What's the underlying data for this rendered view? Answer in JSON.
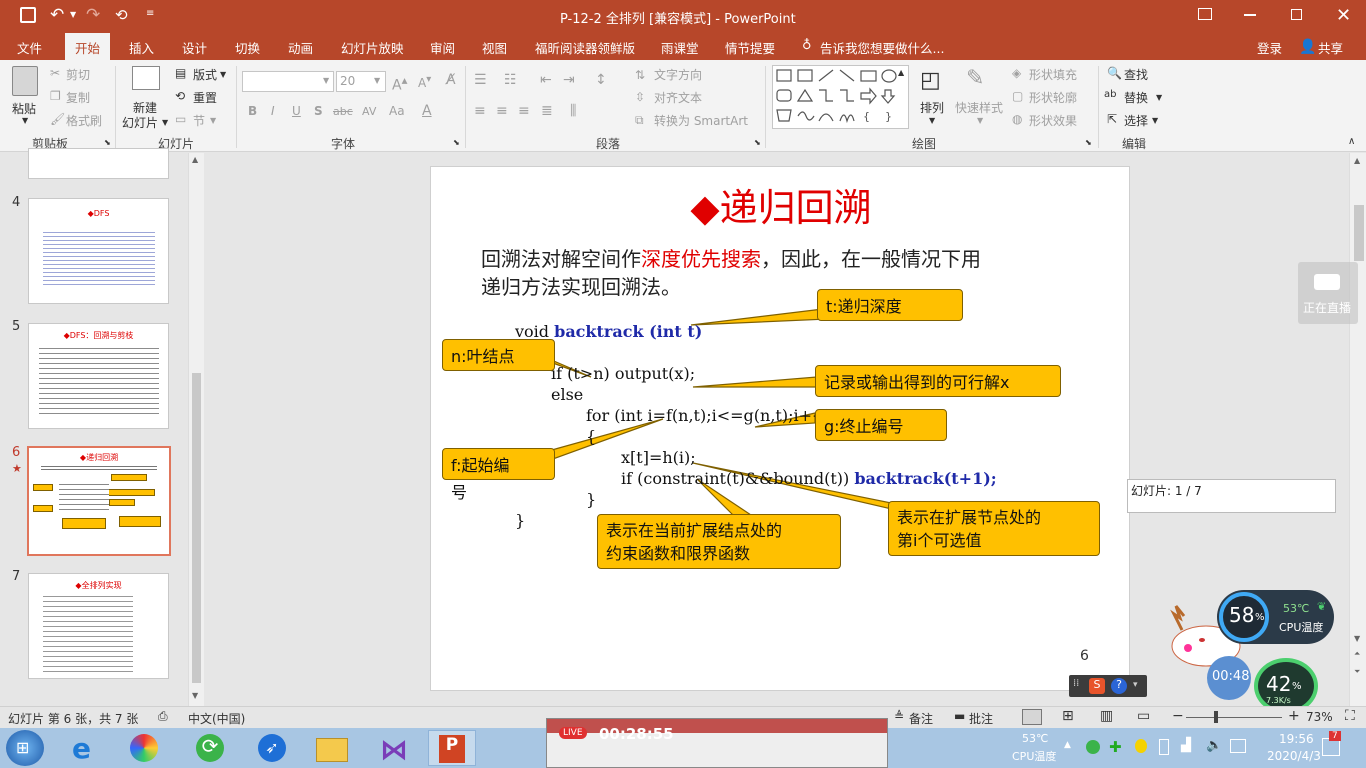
{
  "titlebar": {
    "title": "P-12-2 全排列 [兼容模式] - PowerPoint",
    "save_icon": "save-icon",
    "undo_icon": "undo-icon",
    "redo_icon": "redo-icon",
    "present_icon": "present-icon"
  },
  "tabs": [
    "文件",
    "开始",
    "插入",
    "设计",
    "切换",
    "动画",
    "幻灯片放映",
    "审阅",
    "视图",
    "福昕阅读器领鲜版",
    "雨课堂",
    "情节提要"
  ],
  "tell_me": "告诉我您想要做什么...",
  "login": "登录",
  "share": "共享",
  "ribbon": {
    "clipboard": {
      "paste": "粘贴",
      "cut": "剪切",
      "copy": "复制",
      "format_painter": "格式刷",
      "group": "剪贴板"
    },
    "slides": {
      "new_slide_1": "新建",
      "new_slide_2": "幻灯片",
      "layout": "版式",
      "reset": "重置",
      "section": "节",
      "group": "幻灯片"
    },
    "font": {
      "size": "20",
      "bold": "B",
      "italic": "I",
      "underline": "U",
      "shadow": "S",
      "strike": "abc",
      "spacing": "AV",
      "case": "Aa",
      "group": "字体"
    },
    "paragraph": {
      "text_direction": "文字方向",
      "align_text": "对齐文本",
      "smartart": "转换为 SmartArt",
      "group": "段落"
    },
    "drawing": {
      "arrange": "排列",
      "quick_styles": "快速样式",
      "shape_fill": "形状填充",
      "shape_outline": "形状轮廓",
      "shape_effects": "形状效果",
      "group": "绘图"
    },
    "editing": {
      "find": "查找",
      "replace": "替换",
      "select": "选择",
      "group": "编辑"
    }
  },
  "thumbnails": [
    {
      "num": "4",
      "title": "◆DFS"
    },
    {
      "num": "5",
      "title": "◆DFS：回溯与剪枝"
    },
    {
      "num": "6",
      "title": "◆递归回溯",
      "star": "★"
    },
    {
      "num": "7",
      "title": "◆全排列实现"
    }
  ],
  "slide": {
    "title": "◆递归回溯",
    "intro_1a": "回溯法对解空间作",
    "intro_1b": "深度优先搜索",
    "intro_1c": "，因此，在一般情况下用",
    "intro_2": "递归方法实现回溯法。",
    "code": {
      "line1a": "void ",
      "line1b": "backtrack (int t)",
      "line2": "{",
      "line3": "if (t>n) output(x);",
      "line4": "else",
      "line5": "for (int i=f(n,t);i<=g(n,t);i++)",
      "line6": "{",
      "line7": "x[t]=h(i);",
      "line8a": "if (constraint(t)&&bound(t))  ",
      "line8b": "backtrack(t+1);",
      "line9": "}",
      "line10": "}"
    },
    "callouts": {
      "t": "t:递归深度",
      "n": "n:叶结点",
      "output": "记录或输出得到的可行解x",
      "g": "g:终止编号",
      "f": "f:起始编",
      "f_tail": "号",
      "constraint_1": "表示在当前扩展结点处的",
      "constraint_2": "约束函数和限界函数",
      "h_1": "表示在扩展节点处的",
      "h_2": "第i个可选值"
    },
    "page_number": "6"
  },
  "slide_tooltip": "幻灯片: 1 / 7",
  "live_overlay": "正在直播",
  "cpu_widget": {
    "percent": "58",
    "unit": "%",
    "temp": "53℃",
    "label": "CPU温度"
  },
  "timer": "00:48",
  "net_widget": {
    "percent": "42",
    "unit": "%",
    "speed": "7.3K/s"
  },
  "statusbar": {
    "slide_info": "幻灯片 第 6 张，共 7 张",
    "language": "中文(中国)",
    "notes": "备注",
    "comments": "批注",
    "zoom": "73%"
  },
  "preview": {
    "live": "LIVE",
    "time": "00:28:55"
  },
  "taskbar": {
    "temp": "53℃",
    "temp_label": "CPU温度",
    "time": "19:56",
    "date": "2020/4/3",
    "notif_count": "7"
  }
}
